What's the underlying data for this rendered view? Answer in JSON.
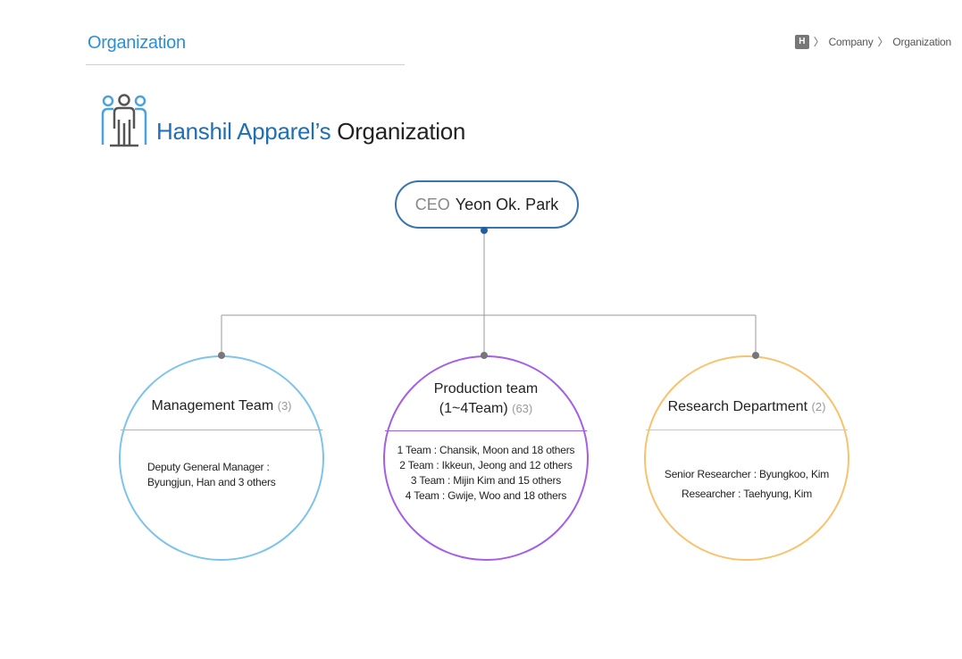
{
  "page_title": "Organization",
  "breadcrumb": {
    "home_icon_label": "H",
    "sep": "〉",
    "items": [
      "Company",
      "Organization"
    ]
  },
  "heading": {
    "company": "Hanshil Apparel’s",
    "rest": "Organization"
  },
  "ceo": {
    "role": "CEO",
    "name": "Yeon Ok. Park"
  },
  "teams": [
    {
      "name": "Management Team",
      "count": "(3)",
      "members": [
        "Deputy General Manager :",
        "Byungjun, Han and 3 others"
      ],
      "color": "#7ec3ec"
    },
    {
      "name": "Production team",
      "name_line2": "(1~4Team)",
      "count": "(63)",
      "members": [
        "1 Team : Chansik, Moon and 18 others",
        "2 Team : Ikkeun, Jeong  and 12 others",
        "3 Team : Mijin Kim and 15 others",
        "4 Team : Gwije, Woo and 18 others"
      ],
      "color": "#a45fe6"
    },
    {
      "name": "Research Department",
      "count": "(2)",
      "members": [
        "Senior Researcher : Byungkoo, Kim",
        "Researcher : Taehyung, Kim"
      ],
      "color": "#f7c36e"
    }
  ],
  "colors": {
    "accent": "#2a8fd8",
    "ceo_border": "#3a74ab",
    "connector": "#9a9a9a"
  }
}
